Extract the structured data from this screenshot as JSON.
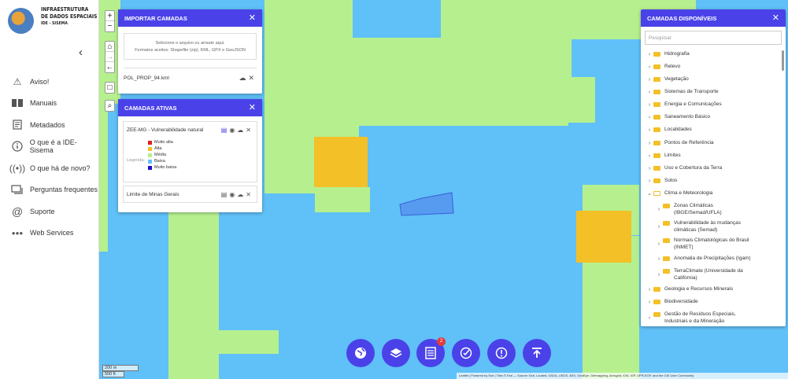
{
  "logo": {
    "line1": "INFRAESTRUTURA",
    "line2": "DE DADOS ESPACIAIS",
    "line3": "IDE - SISEMA"
  },
  "sidebar": {
    "collapse_glyph": "‹",
    "items": [
      {
        "label": "Aviso!",
        "icon": "warning-icon"
      },
      {
        "label": "Manuais",
        "icon": "book-icon"
      },
      {
        "label": "Metadados",
        "icon": "document-icon"
      },
      {
        "label": "O que é a IDE-Sisema",
        "icon": "info-icon"
      },
      {
        "label": "O que há de novo?",
        "icon": "broadcast-icon"
      },
      {
        "label": "Perguntas frequentes",
        "icon": "chat-icon"
      },
      {
        "label": "Suporte",
        "icon": "at-icon"
      },
      {
        "label": "Web Services",
        "icon": "dots-icon"
      }
    ]
  },
  "import_panel": {
    "title": "IMPORTAR CAMADAS",
    "drop_line1": "Selecione o arquivo ou arraste aqui.",
    "drop_line2": "Formatos aceitos: Shapefile (zip), KML, GPX e GeoJSON",
    "file_name": "POL_PROP_94.kml"
  },
  "active_panel": {
    "title": "CAMADAS ATIVAS",
    "layer1": "ZEE-MG - Vulnerabilidade natural",
    "legend_label": "Legenda:",
    "legend": [
      {
        "label": "Muito alta",
        "color": "#e02020"
      },
      {
        "label": "Alta",
        "color": "#f4c027"
      },
      {
        "label": "Média",
        "color": "#b6f08e"
      },
      {
        "label": "Baixa",
        "color": "#60c0f8"
      },
      {
        "label": "Muito baixa",
        "color": "#1a10c8"
      }
    ],
    "layer2": "Limite de Minas Gerais"
  },
  "available_panel": {
    "title": "CAMADAS DISPONÍVEIS",
    "search_placeholder": "Pesquisar",
    "items": [
      {
        "label": "Hidrografia"
      },
      {
        "label": "Relevo"
      },
      {
        "label": "Vegetação"
      },
      {
        "label": "Sistemas de Transporte"
      },
      {
        "label": "Energia e Comunicações"
      },
      {
        "label": "Saneamento Básico"
      },
      {
        "label": "Localidades"
      },
      {
        "label": "Pontos de Referência"
      },
      {
        "label": "Limites"
      },
      {
        "label": "Uso e Cobertura da Terra"
      },
      {
        "label": "Solos"
      },
      {
        "label": "Clima e Meteorologia"
      },
      {
        "label": "Zonas Climáticas",
        "label2": "(IBGE/Semad/UFLA)"
      },
      {
        "label": "Vulnerabilidade às mudanças",
        "label2": "climáticas (Semad)"
      },
      {
        "label": "Normais Climatológicas do Brasil",
        "label2": "(INMET)"
      },
      {
        "label": "Anomalia de Precipitações (Igam)"
      },
      {
        "label": "TerraClimate (Universidade da",
        "label2": "Califórnia)"
      },
      {
        "label": "Geologia e Recursos Minerais"
      },
      {
        "label": "Biodiversidade"
      },
      {
        "label": "Gestão de Resíduos Especiais,",
        "label2": "Industriais e da Mineração"
      }
    ]
  },
  "controls": {
    "zoom_in": "+",
    "zoom_out": "−",
    "home": "⌂",
    "forward": "→",
    "back": "←",
    "frame": "□",
    "search": "⌕"
  },
  "fabs": {
    "badge_count": "2"
  },
  "scale": {
    "m": "200 m",
    "ft": "500 ft"
  },
  "attribution": "Leaflet | Powered by Esri | Tiles © Esri — Source: Esri, i-cubed, USDA, USGS, AEX, GeoEye, Getmapping, Aerogrid, IGN, IGP, UPR-EGP, and the GIS User Community",
  "colors": {
    "accent": "#4a42e8",
    "water": "#60c0f8",
    "green": "#b6f08e",
    "orange": "#f4c027"
  }
}
